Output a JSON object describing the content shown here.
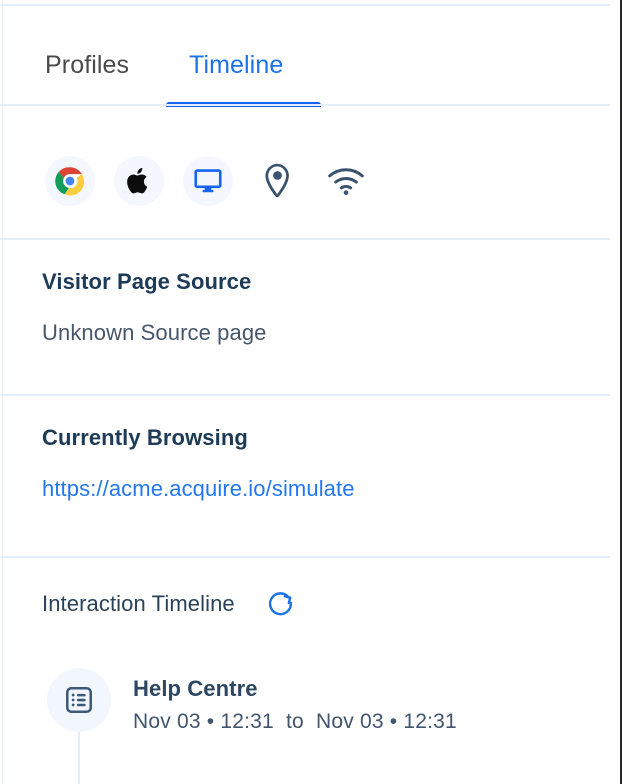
{
  "colors": {
    "accent_blue": "#1a73e8",
    "underline_blue": "#1463f3",
    "link_blue": "#2277f0",
    "heading_navy": "#1d3a56",
    "body_slate": "#46576b",
    "icon_slate": "#39536f",
    "divider": "#e6edfa",
    "bubble_bg": "#f2f6fd"
  },
  "tabs": [
    {
      "label": "Profiles",
      "active": false,
      "name": "tab-profiles"
    },
    {
      "label": "Timeline",
      "active": true,
      "name": "tab-timeline"
    }
  ],
  "status_icons": [
    {
      "name": "chrome-icon",
      "label": "Chrome",
      "circled": true
    },
    {
      "name": "apple-icon",
      "label": "Apple macOS",
      "circled": true
    },
    {
      "name": "monitor-icon",
      "label": "Desktop",
      "circled": true
    },
    {
      "name": "location-pin-icon",
      "label": "Location",
      "circled": false
    },
    {
      "name": "wifi-icon",
      "label": "Network",
      "circled": false
    }
  ],
  "page_source": {
    "title": "Visitor Page Source",
    "value": "Unknown Source page"
  },
  "currently_browsing": {
    "title": "Currently Browsing",
    "url": "https://acme.acquire.io/simulate"
  },
  "interaction_timeline": {
    "title": "Interaction Timeline",
    "refresh_label": "Refresh",
    "items": [
      {
        "icon": "list-document-icon",
        "title": "Help Centre",
        "time_range": "Nov 03 • 12:31  to  Nov 03 • 12:31"
      }
    ]
  }
}
